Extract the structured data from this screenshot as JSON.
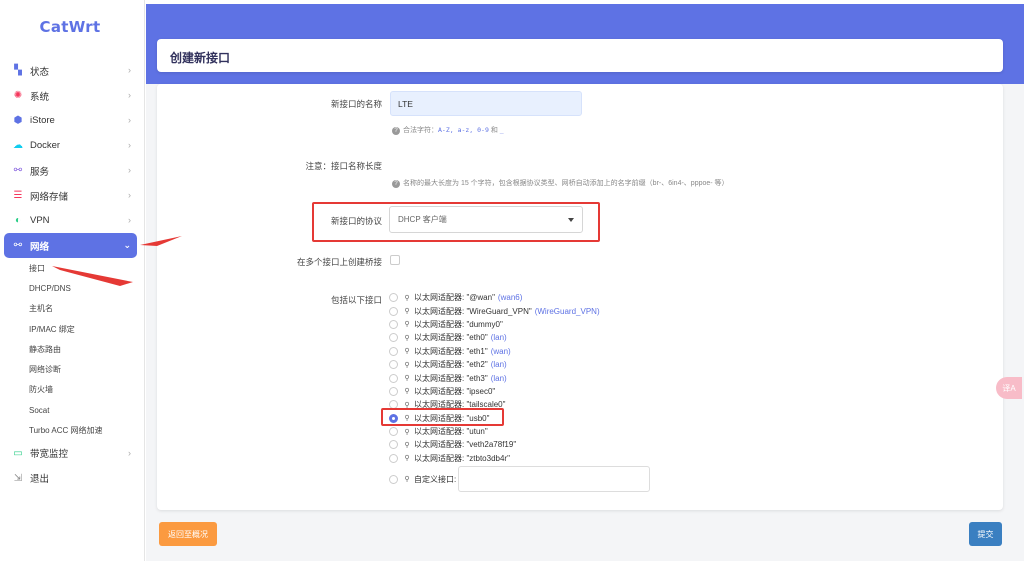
{
  "brand": "CatWrt",
  "sidebar": {
    "items": [
      {
        "label": "状态",
        "icon": "dashboard-icon",
        "color": "#5e72e4"
      },
      {
        "label": "系统",
        "icon": "gear-icon",
        "color": "#f5365c"
      },
      {
        "label": "iStore",
        "icon": "box-icon",
        "color": "#5e72e4"
      },
      {
        "label": "Docker",
        "icon": "docker-icon",
        "color": "#11cdef"
      },
      {
        "label": "服务",
        "icon": "share-icon",
        "color": "#8965e0"
      },
      {
        "label": "网络存储",
        "icon": "database-icon",
        "color": "#f5365c"
      },
      {
        "label": "VPN",
        "icon": "vpn-icon",
        "color": "#2dce89"
      },
      {
        "label": "网络",
        "icon": "network-icon",
        "active": true
      }
    ],
    "network_sub": [
      "接口",
      "DHCP/DNS",
      "主机名",
      "IP/MAC 绑定",
      "静态路由",
      "网络诊断",
      "防火墙",
      "Socat",
      "Turbo ACC 网络加速"
    ],
    "after": [
      {
        "label": "带宽监控",
        "icon": "monitor-icon",
        "color": "#2dce89"
      },
      {
        "label": "退出",
        "icon": "logout-icon",
        "color": "#888"
      }
    ]
  },
  "page": {
    "title": "创建新接口"
  },
  "form": {
    "name_label": "新接口的名称",
    "name_value": "LTE",
    "name_hint_prefix": "合法字符：",
    "name_hint_code": "A-Z, a-z, 0-9",
    "name_hint_and": " 和 ",
    "name_hint_underscore": "_",
    "note_label": "注意：接口名称长度",
    "note_hint": "名称的最大长度为 15 个字符，包含根据协议类型、网桥自动添加上的名字前缀（br-、6in4-、pppoe- 等）",
    "protocol_label": "新接口的协议",
    "protocol_value": "DHCP 客户端",
    "bridge_label": "在多个接口上创建桥接",
    "include_label": "包括以下接口",
    "interfaces": [
      {
        "text": "以太网适配器: \"@wan\"",
        "zone": "(wan6)",
        "checked": false
      },
      {
        "text": "以太网适配器: \"WireGuard_VPN\"",
        "zone": "(WireGuard_VPN)",
        "checked": false
      },
      {
        "text": "以太网适配器: \"dummy0\"",
        "zone": "",
        "checked": false
      },
      {
        "text": "以太网适配器: \"eth0\"",
        "zone": "(lan)",
        "checked": false
      },
      {
        "text": "以太网适配器: \"eth1\"",
        "zone": "(wan)",
        "checked": false
      },
      {
        "text": "以太网适配器: \"eth2\"",
        "zone": "(lan)",
        "checked": false
      },
      {
        "text": "以太网适配器: \"eth3\"",
        "zone": "(lan)",
        "checked": false
      },
      {
        "text": "以太网适配器: \"ipsec0\"",
        "zone": "",
        "checked": false
      },
      {
        "text": "以太网适配器: \"tailscale0\"",
        "zone": "",
        "checked": false
      },
      {
        "text": "以太网适配器: \"usb0\"",
        "zone": "",
        "checked": true
      },
      {
        "text": "以太网适配器: \"utun\"",
        "zone": "",
        "checked": false
      },
      {
        "text": "以太网适配器: \"veth2a78f19\"",
        "zone": "",
        "checked": false
      },
      {
        "text": "以太网适配器: \"ztbto3db4r\"",
        "zone": "",
        "checked": false
      }
    ],
    "custom_label": "自定义接口:"
  },
  "buttons": {
    "back": "返回至概况",
    "submit": "提交"
  },
  "float_button": "译A",
  "colors": {
    "accent": "#5e72e4",
    "annotation_red": "#e53935",
    "back_button": "#fb9a40",
    "submit_button": "#3a7fc1"
  }
}
